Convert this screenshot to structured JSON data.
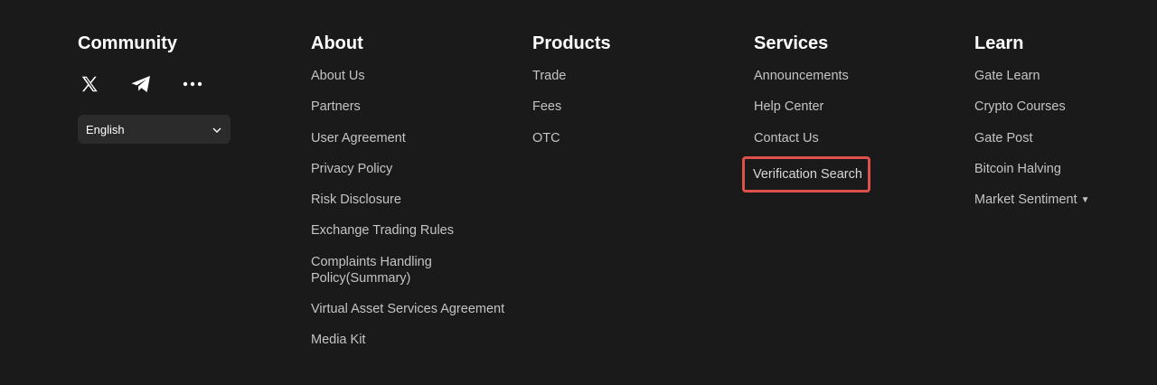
{
  "community": {
    "heading": "Community",
    "icons": [
      "x-icon",
      "telegram-icon",
      "more-icon"
    ],
    "language": {
      "selected": "English"
    }
  },
  "about": {
    "heading": "About",
    "links": [
      "About Us",
      "Partners",
      "User Agreement",
      "Privacy Policy",
      "Risk Disclosure",
      "Exchange Trading Rules",
      "Complaints Handling Policy(Summary)",
      "Virtual Asset Services Agreement",
      "Media Kit"
    ]
  },
  "products": {
    "heading": "Products",
    "links": [
      "Trade",
      "Fees",
      "OTC"
    ]
  },
  "services": {
    "heading": "Services",
    "links": [
      "Announcements",
      "Help Center",
      "Contact Us",
      "Verification Search"
    ]
  },
  "learn": {
    "heading": "Learn",
    "links": [
      "Gate Learn",
      "Crypto Courses",
      "Gate Post",
      "Bitcoin Halving",
      "Market Sentiment"
    ]
  },
  "colors": {
    "background": "#1a1a1a",
    "heading": "#ffffff",
    "link": "#c4c4c4",
    "highlight_border": "#e0504a",
    "select_bg": "#2b2b2b"
  }
}
